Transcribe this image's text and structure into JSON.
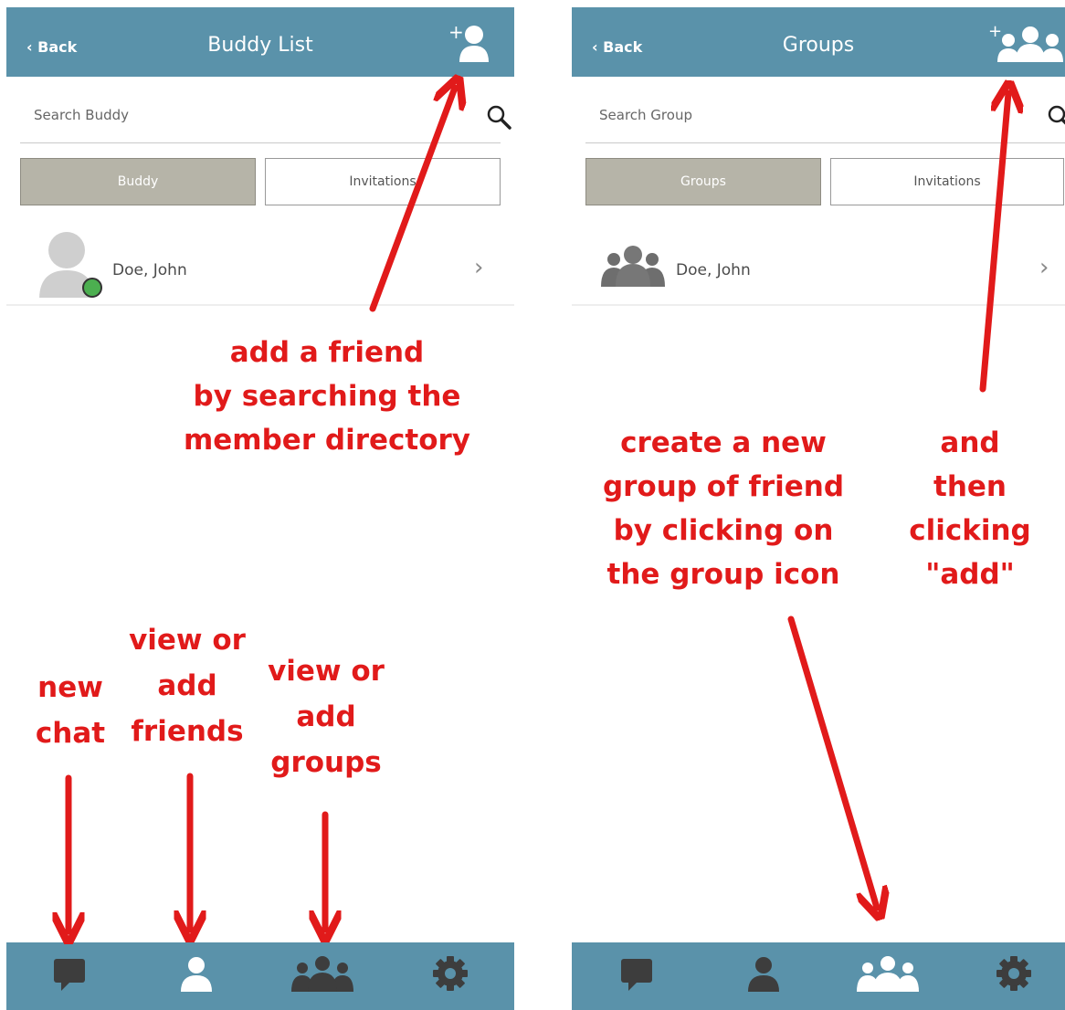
{
  "buddy_screen": {
    "back_label": "Back",
    "title": "Buddy List",
    "add_icon": "add-buddy-icon",
    "search": {
      "placeholder": "Search Buddy"
    },
    "tabs": [
      {
        "label": "Buddy",
        "active": true
      },
      {
        "label": "Invitations",
        "active": false
      }
    ],
    "list": [
      {
        "name": "Doe, John",
        "status": "online",
        "status_color": "#4caf50"
      }
    ],
    "bottom_tabs": [
      {
        "icon": "chat-icon",
        "active": false
      },
      {
        "icon": "person-icon",
        "active": true
      },
      {
        "icon": "groups-icon",
        "active": false
      },
      {
        "icon": "gear-icon",
        "active": false
      }
    ]
  },
  "groups_screen": {
    "back_label": "Back",
    "title": "Groups",
    "add_icon": "add-group-icon",
    "search": {
      "placeholder": "Search Group"
    },
    "tabs": [
      {
        "label": "Groups",
        "active": true
      },
      {
        "label": "Invitations",
        "active": false
      }
    ],
    "list": [
      {
        "name": "Doe, John"
      }
    ],
    "bottom_tabs": [
      {
        "icon": "chat-icon",
        "active": false
      },
      {
        "icon": "person-icon",
        "active": false
      },
      {
        "icon": "groups-icon",
        "active": true
      },
      {
        "icon": "gear-icon",
        "active": false
      }
    ]
  },
  "annotations": {
    "add_friend": [
      "add a friend",
      "by searching the",
      "member directory"
    ],
    "create_group": [
      "create a new",
      "group of friend",
      "by clicking on",
      "the group icon"
    ],
    "then_add": [
      "and",
      "then",
      "clicking",
      "\"add\""
    ],
    "new_chat": [
      "new",
      "chat"
    ],
    "view_friends": [
      "view or",
      "add",
      "friends"
    ],
    "view_groups": [
      "view or",
      "add",
      "groups"
    ]
  },
  "colors": {
    "header": "#5a92aa",
    "annotation": "#e11a1a",
    "active_tab": "#b6b4a8",
    "icon_dark": "#3d3d3d",
    "icon_white": "#ffffff",
    "avatar_gray": "#cfcfcf"
  }
}
